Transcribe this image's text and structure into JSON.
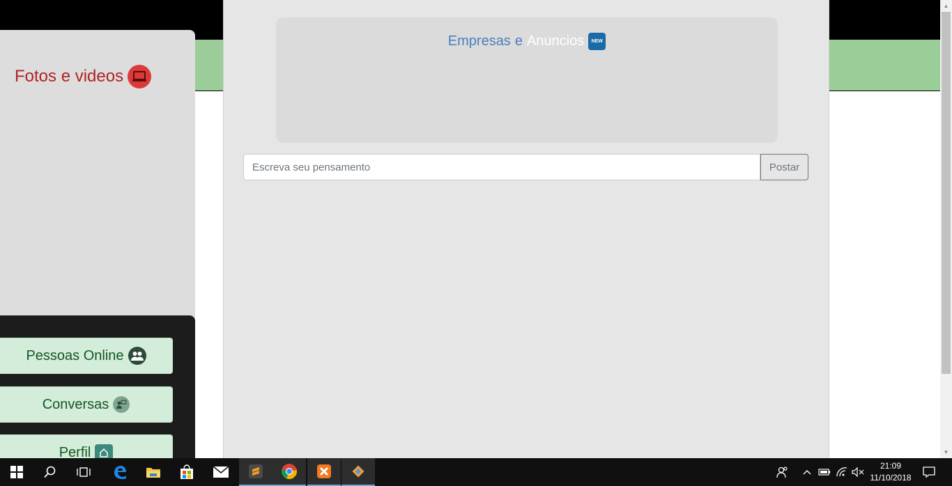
{
  "left_sidebar": {
    "gallery_title": "Fotos e videos",
    "gallery_icon": "laptop-icon",
    "buttons": [
      {
        "label": "Pessoas Online",
        "icon": "users-icon"
      },
      {
        "label": "Conversas",
        "icon": "chat-icon"
      },
      {
        "label": "Perfil",
        "icon": "home-icon"
      }
    ]
  },
  "main": {
    "ads": {
      "title_part1": "Empresas",
      "title_part2": "e",
      "title_part3": "Anuncios",
      "badge_text": "NEW"
    },
    "post": {
      "placeholder": "Escreva seu pensamento",
      "button_label": "Postar"
    }
  },
  "colors": {
    "topbar": "#000000",
    "greenbar": "#9acd98",
    "gallery_title": "#b22222",
    "button_bg": "#d4edda",
    "button_text": "#155724",
    "ads_accent": "#4a7fba"
  },
  "taskbar": {
    "items": [
      "windows-start-icon",
      "search-icon",
      "task-view-icon",
      "edge-icon",
      "file-explorer-icon",
      "store-icon",
      "mail-icon",
      "sublime-text-icon",
      "chrome-icon",
      "xampp-icon",
      "git-icon"
    ],
    "active_item": "chrome-icon",
    "tray_icons": [
      "people-icon",
      "chevron-up-icon",
      "battery-icon",
      "wifi-icon",
      "volume-muted-icon",
      "notification-icon"
    ],
    "time": "21:09",
    "date": "11/10/2018"
  }
}
